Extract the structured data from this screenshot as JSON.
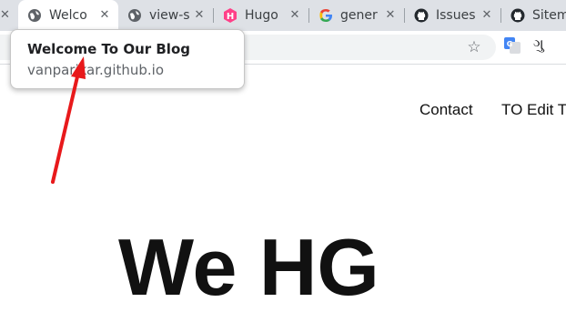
{
  "tabs": [
    {
      "title": "Welco",
      "icon": "globe-icon",
      "active": true
    },
    {
      "title": "view-s",
      "icon": "globe-icon"
    },
    {
      "title": "Hugo",
      "icon": "hugo-icon"
    },
    {
      "title": "gener",
      "icon": "google-icon"
    },
    {
      "title": "Issues",
      "icon": "github-icon"
    },
    {
      "title": "Sitem",
      "icon": "github-icon"
    }
  ],
  "toolbar": {
    "extension_text": "ગુ"
  },
  "tooltip": {
    "title": "Welcome To Our Blog",
    "url": "vanparikar.github.io"
  },
  "page": {
    "nav": [
      "Contact",
      "TO Edit T"
    ],
    "hero": "We HG"
  },
  "colors": {
    "annotation_arrow": "#e8191b",
    "hugo_brand": "#ff4088"
  }
}
